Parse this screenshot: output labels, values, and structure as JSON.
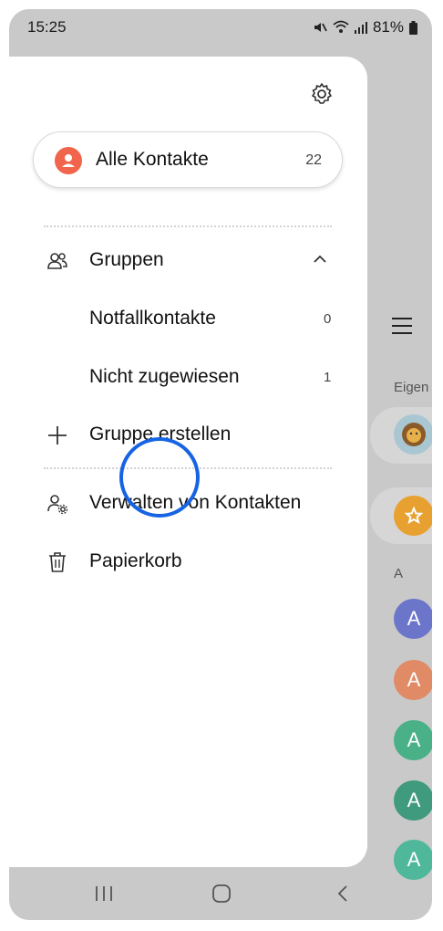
{
  "status_bar": {
    "time": "15:25",
    "battery": "81%",
    "icons": [
      "mute-icon",
      "wifi-icon",
      "signal-icon",
      "battery-icon"
    ]
  },
  "drawer": {
    "settings_icon": "gear-icon",
    "all_contacts": {
      "label": "Alle Kontakte",
      "count": "22"
    },
    "groups": {
      "label": "Gruppen",
      "items": [
        {
          "label": "Notfallkontakte",
          "count": "0"
        },
        {
          "label": "Nicht zugewiesen",
          "count": "1"
        }
      ],
      "create_label": "Gruppe erstellen"
    },
    "manage_label": "Verwalten von Kontakten",
    "trash_label": "Papierkorb"
  },
  "background_list": {
    "section_own": "Eigen",
    "section_a": "A",
    "avatar_letter": "A",
    "avatar_colors": [
      "#6b75c9",
      "#e08a66",
      "#49b088",
      "#3f9a7e",
      "#4fb79a"
    ]
  },
  "colors": {
    "accent_orange": "#f0654b",
    "touch_indicator": "#1664e3",
    "star_avatar": "#e8a030"
  }
}
